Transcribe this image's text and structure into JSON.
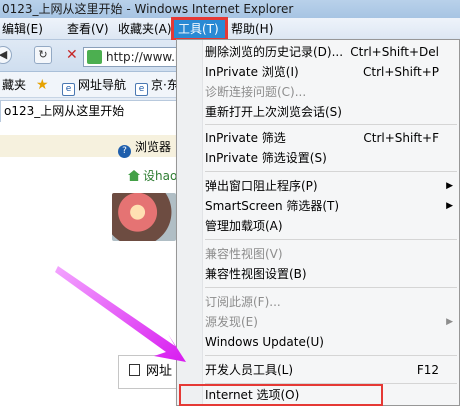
{
  "window": {
    "title": "0123_上网从这里开始 - Windows Internet Explorer"
  },
  "menubar": {
    "items": [
      {
        "label": "编辑(E)"
      },
      {
        "label": "查看(V)"
      },
      {
        "label": "收藏夹(A)"
      },
      {
        "label": "工具(T)"
      },
      {
        "label": "帮助(H)"
      }
    ]
  },
  "address": {
    "url": "http://www.h",
    "stop_glyph": "✕"
  },
  "favorites": {
    "items": [
      {
        "label": "藏夹"
      },
      {
        "label": "网址导航"
      },
      {
        "label": "京·东"
      }
    ]
  },
  "tab": {
    "title": "o123_上网从这里开始"
  },
  "page": {
    "help_text": "浏览器",
    "sethome_text": "设hao",
    "search_tab_label": "网址"
  },
  "tools_menu": {
    "items": [
      {
        "label": "删除浏览的历史记录(D)...",
        "shortcut": "Ctrl+Shift+Del",
        "enabled": true,
        "submenu": false
      },
      {
        "label": "InPrivate 浏览(I)",
        "shortcut": "Ctrl+Shift+P",
        "enabled": true,
        "submenu": false
      },
      {
        "label": "诊断连接问题(C)...",
        "shortcut": "",
        "enabled": false,
        "submenu": false
      },
      {
        "label": "重新打开上次浏览会话(S)",
        "shortcut": "",
        "enabled": true,
        "submenu": false
      },
      {
        "label": "InPrivate 筛选",
        "shortcut": "Ctrl+Shift+F",
        "enabled": true,
        "submenu": false
      },
      {
        "label": "InPrivate 筛选设置(S)",
        "shortcut": "",
        "enabled": true,
        "submenu": false
      },
      {
        "label": "弹出窗口阻止程序(P)",
        "shortcut": "",
        "enabled": true,
        "submenu": true
      },
      {
        "label": "SmartScreen 筛选器(T)",
        "shortcut": "",
        "enabled": true,
        "submenu": true
      },
      {
        "label": "管理加载项(A)",
        "shortcut": "",
        "enabled": true,
        "submenu": false
      },
      {
        "label": "兼容性视图(V)",
        "shortcut": "",
        "enabled": false,
        "submenu": false
      },
      {
        "label": "兼容性视图设置(B)",
        "shortcut": "",
        "enabled": true,
        "submenu": false
      },
      {
        "label": "订阅此源(F)...",
        "shortcut": "",
        "enabled": false,
        "submenu": false
      },
      {
        "label": "源发现(E)",
        "shortcut": "",
        "enabled": false,
        "submenu": true
      },
      {
        "label": "Windows Update(U)",
        "shortcut": "",
        "enabled": true,
        "submenu": false
      },
      {
        "label": "开发人员工具(L)",
        "shortcut": "F12",
        "enabled": true,
        "submenu": false
      },
      {
        "label": "Internet 选项(O)",
        "shortcut": "",
        "enabled": true,
        "submenu": false
      }
    ]
  },
  "colors": {
    "highlight_red": "#e53935",
    "menu_active_blue": "#2a8ad4",
    "annotation_arrow": "#e040fb"
  },
  "icons": {
    "back": "back-arrow-icon",
    "refresh": "refresh-icon",
    "stop": "stop-icon",
    "favorites_star": "star-icon",
    "help": "help-icon",
    "home": "home-icon"
  }
}
